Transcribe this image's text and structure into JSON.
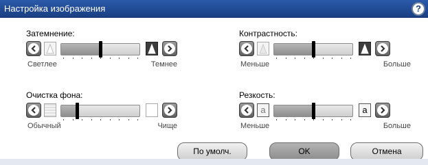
{
  "window": {
    "title": "Настройка изображения",
    "help_label": "?"
  },
  "controls": {
    "darkness": {
      "label": "Затемнение:",
      "left": "Светлее",
      "right": "Темнее",
      "value": 0.5
    },
    "contrast": {
      "label": "Контрастность:",
      "left": "Меньше",
      "right": "Больше",
      "value": 0.5
    },
    "background": {
      "label": "Очистка фона:",
      "left": "Обычный",
      "right": "Чище",
      "value": 0.2
    },
    "sharpness": {
      "label": "Резкость:",
      "left": "Меньше",
      "right": "Больше",
      "value": 0.5,
      "end_letter_left": "a",
      "end_letter_right": "a"
    }
  },
  "buttons": {
    "default": "По умолч.",
    "ok": "OK",
    "cancel": "Отмена"
  },
  "colors": {
    "titlebar": "#1a3f83",
    "thumb": "#000000",
    "track": "#cfcfcf"
  }
}
